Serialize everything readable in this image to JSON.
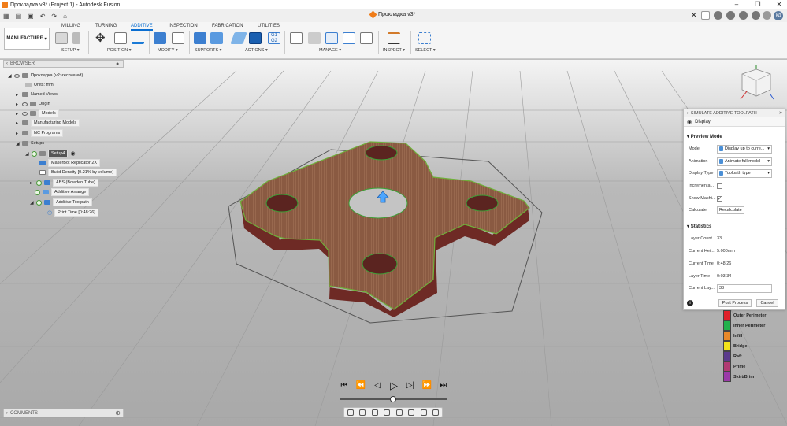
{
  "window": {
    "title": "Прокладка v3* (Project 1) - Autodesk Fusion",
    "doc_tab": "Прокладка v3*",
    "user_initials": "КД"
  },
  "workspace": {
    "label": "MANUFACTURE"
  },
  "ribbon": {
    "tabs": [
      "MILLING",
      "TURNING",
      "ADDITIVE",
      "INSPECTION",
      "FABRICATION",
      "UTILITIES"
    ],
    "active_tab": "ADDITIVE",
    "groups": [
      "SETUP",
      "POSITION",
      "MODIFY",
      "SUPPORTS",
      "ACTIONS",
      "MANAGE",
      "INSPECT",
      "SELECT"
    ]
  },
  "browser": {
    "title": "BROWSER",
    "items": [
      {
        "label": "Прокладка (v2~recovered)"
      },
      {
        "label": "Units: mm"
      },
      {
        "label": "Named Views"
      },
      {
        "label": "Origin"
      },
      {
        "label": "Models"
      },
      {
        "label": "Manufacturing Models"
      },
      {
        "label": "NC Programs"
      },
      {
        "label": "Setups"
      },
      {
        "label": "Setup4"
      },
      {
        "label": "MakerBot Replicator 2X"
      },
      {
        "label": "Build Density [0.21% by volume]"
      },
      {
        "label": "ABS (Bowden Tube)"
      },
      {
        "label": "Additive Arrange"
      },
      {
        "label": "Additive Toolpath"
      },
      {
        "label": "Print Time [0:48:26]"
      }
    ]
  },
  "simulate": {
    "title": "SIMULATE ADDITIVE TOOLPATH",
    "tab": "Display",
    "preview_title": "Preview Mode",
    "mode_label": "Mode",
    "mode_value": "Display up to curre...",
    "animation_label": "Animation",
    "animation_value": "Animate full model",
    "display_type_label": "Display Type",
    "display_type_value": "Toolpath type",
    "incremental_label": "Incrementa...",
    "show_machine_label": "Show Machi...",
    "calculate_label": "Calculate",
    "recalculate_label": "Recalculate",
    "stats_title": "Statistics",
    "layer_count_label": "Layer Count",
    "layer_count_value": "33",
    "current_height_label": "Current Hei...",
    "current_height_value": "5.000mm",
    "current_time_label": "Current Time",
    "current_time_value": "0:48:26",
    "layer_time_label": "Layer Time",
    "layer_time_value": "0:03:34",
    "current_layer_label": "Current Lay...",
    "current_layer_value": "33",
    "post_process_label": "Post Process",
    "cancel_label": "Cancel",
    "incremental_checked": false,
    "show_machine_checked": true
  },
  "legend": [
    {
      "label": "Outer Perimeter",
      "color": "#e0202a"
    },
    {
      "label": "Inner Perimeter",
      "color": "#22b14c"
    },
    {
      "label": "Infill",
      "color": "#e8882a"
    },
    {
      "label": "Bridge",
      "color": "#f2e31b"
    },
    {
      "label": "Raft",
      "color": "#5a3a8c"
    },
    {
      "label": "Prime",
      "color": "#b03a72"
    },
    {
      "label": "Skirt/Brim",
      "color": "#9b3aa8"
    }
  ],
  "comments": {
    "title": "COMMENTS"
  }
}
